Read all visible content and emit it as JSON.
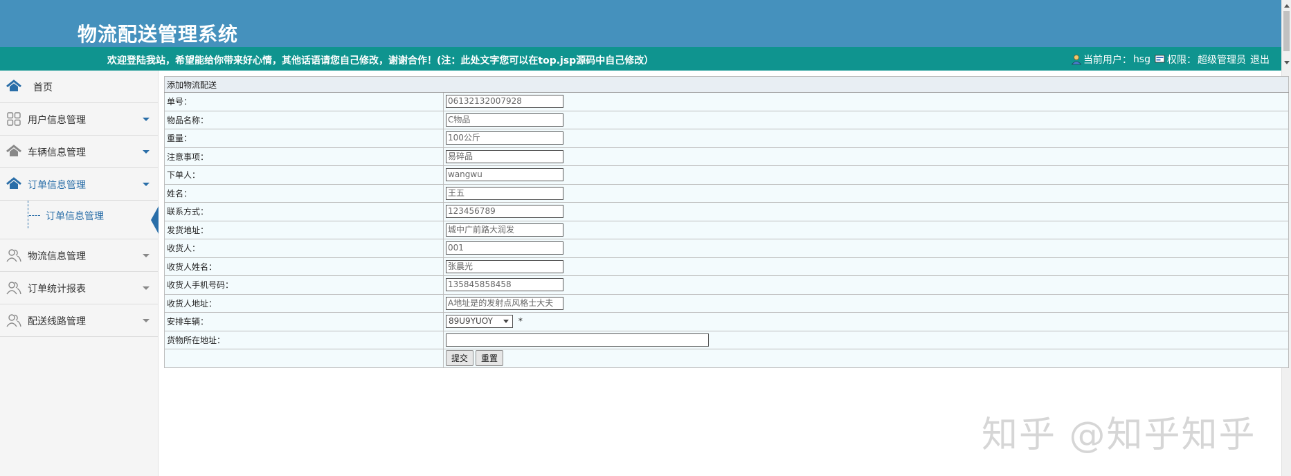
{
  "header": {
    "title": "物流配送管理系统",
    "welcome": "欢迎登陆我站，希望能给你带来好心情，其他话语请您自己修改，谢谢合作！(注：此处文字您可以在top.jsp源码中自己修改）",
    "current_user_label": "当前用户：",
    "current_user": "hsg",
    "role_label": "权限：",
    "role": "超级管理员",
    "logout": "退出"
  },
  "sidebar": {
    "home": "首页",
    "items": [
      {
        "label": "用户信息管理",
        "icon": "grid-icon"
      },
      {
        "label": "车辆信息管理",
        "icon": "home-icon"
      },
      {
        "label": "订单信息管理",
        "icon": "home-icon"
      },
      {
        "label": "物流信息管理",
        "icon": "users-icon"
      },
      {
        "label": "订单统计报表",
        "icon": "users-icon"
      },
      {
        "label": "配送线路管理",
        "icon": "users-icon"
      }
    ],
    "submenu_item": "订单信息管理"
  },
  "form": {
    "caption": "添加物流配送",
    "fields": [
      {
        "label": "单号：",
        "value": "06132132007928"
      },
      {
        "label": "物品名称：",
        "value": "C物品"
      },
      {
        "label": "重量：",
        "value": "100公斤"
      },
      {
        "label": "注意事项：",
        "value": "易碎品"
      },
      {
        "label": "下单人：",
        "value": "wangwu"
      },
      {
        "label": "姓名：",
        "value": "王五"
      },
      {
        "label": "联系方式：",
        "value": "123456789"
      },
      {
        "label": "发货地址：",
        "value": "城中广前路大润发"
      },
      {
        "label": "收货人：",
        "value": "001"
      },
      {
        "label": "收货人姓名：",
        "value": "张晨光"
      },
      {
        "label": "收货人手机号码：",
        "value": "135845858458"
      },
      {
        "label": "收货人地址：",
        "value": "A地址是的发射点风格士大夫"
      }
    ],
    "vehicle_label": "安排车辆：",
    "vehicle_value": "89U9YUOY",
    "required_mark": "*",
    "location_label": "货物所在地址：",
    "location_value": "",
    "submit": "提交",
    "reset": "重置"
  },
  "watermark": "知乎 @知乎知乎",
  "colors": {
    "banner": "#4591bd",
    "topbar": "#0f948f",
    "accent": "#2a6ea8"
  }
}
